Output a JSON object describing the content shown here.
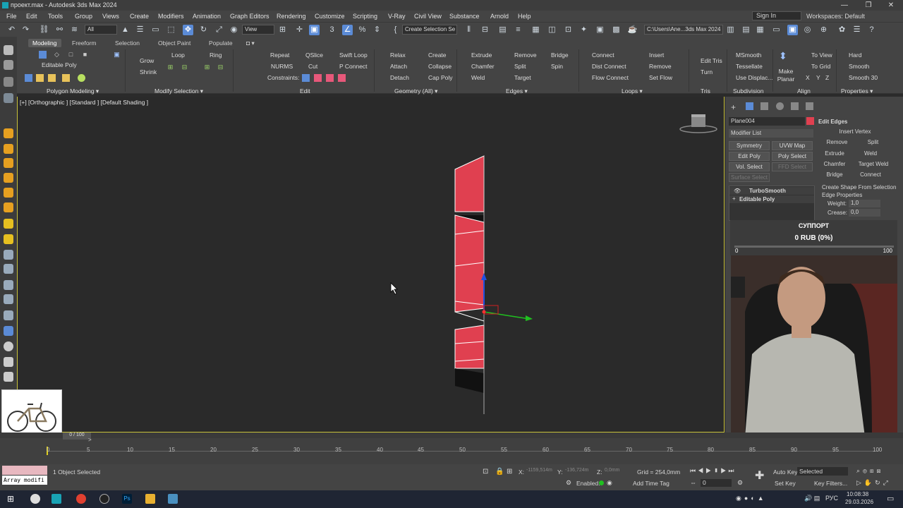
{
  "window": {
    "title": "проект.max - Autodesk 3ds Max 2024",
    "buttons": [
      "—",
      "❐",
      "✕"
    ]
  },
  "menu": {
    "items": [
      "File",
      "Edit",
      "Tools",
      "Group",
      "Views",
      "Create",
      "Modifiers",
      "Animation",
      "Graph Editors",
      "Rendering",
      "Customize",
      "Scripting",
      "V-Ray",
      "Civil View",
      "Substance",
      "Arnold",
      "Help"
    ],
    "signin": "Sign In",
    "workspaces": "Workspaces: Default"
  },
  "toolbar": {
    "filter": "All",
    "view": "View",
    "selset": "Create Selection Se",
    "path": "C:\\Users\\Ane...3ds Max 2024"
  },
  "ribbon": {
    "tabs": [
      "Modeling",
      "Freeform",
      "Selection",
      "Object Paint",
      "Populate"
    ],
    "editable_poly": "Editable Poly",
    "grow": "Grow",
    "shrink": "Shrink",
    "loop": "Loop",
    "ring": "Ring",
    "repeat": "Repeat",
    "qslice": "QSlice",
    "swift_loop": "Swift Loop",
    "nurms": "NURMS",
    "cut": "Cut",
    "p_connect": "P Connect",
    "constraints": "Constraints:",
    "relax": "Relax",
    "create": "Create",
    "attach": "Attach",
    "collapse": "Collapse",
    "detach": "Detach",
    "cap_poly": "Cap Poly",
    "extrude": "Extrude",
    "remove": "Remove",
    "bridge": "Bridge",
    "chamfer": "Chamfer",
    "split": "Split",
    "spin": "Spin",
    "weld": "Weld",
    "target": "Target",
    "connect": "Connect",
    "insert": "Insert",
    "dist_connect": "Dist Connect",
    "remove2": "Remove",
    "flow_connect": "Flow Connect",
    "set_flow": "Set Flow",
    "edit_tris": "Edit Tris",
    "turn": "Turn",
    "msmooth": "MSmooth",
    "tessellate": "Tessellate",
    "use_displac": "Use Displac...",
    "make_planar": "Make Planar",
    "to_view": "To View",
    "to_grid": "To Grid",
    "xyz": [
      "X",
      "Y",
      "Z"
    ],
    "hard": "Hard",
    "smooth": "Smooth",
    "smooth30": "Smooth 30",
    "groups": {
      "polygon_modeling": "Polygon Modeling ▾",
      "modify_selection": "Modify Selection ▾",
      "edit": "Edit",
      "geometry": "Geometry (All) ▾",
      "edges": "Edges ▾",
      "loops": "Loops ▾",
      "tris": "Tris",
      "subdivision": "Subdivision",
      "align": "Align",
      "properties": "Properties ▾"
    }
  },
  "viewport": {
    "label": "[+] [Orthographic ] [Standard ] [Default Shading ]"
  },
  "command_panel": {
    "object_name": "Plane004",
    "modifier_list": "Modifier List",
    "mod_buttons": [
      "Symmetry",
      "UVW Map",
      "Edit Poly",
      "Poly Select",
      "Vol. Select",
      "FFD Select",
      "Surface Select"
    ],
    "stack": [
      "TurboSmooth",
      "Editable Poly"
    ],
    "rollout_title": "Edit Edges",
    "insert_vertex": "Insert Vertex",
    "remove": "Remove",
    "split": "Split",
    "extrude": "Extrude",
    "weld": "Weld",
    "chamfer": "Chamfer",
    "target_weld": "Target Weld",
    "bridge": "Bridge",
    "connect": "Connect",
    "create_shape": "Create Shape From Selection",
    "edge_properties": "Edge Properties",
    "weight_label": "Weight:",
    "weight": "1,0",
    "crease_label": "Crease:",
    "crease": "0,0"
  },
  "support": {
    "title": "СУППОРТ",
    "amount": "0 RUB (0%)",
    "min": "0",
    "max": "100",
    "progress": 0
  },
  "timeline": {
    "ticks": [
      "0",
      "5",
      "10",
      "15",
      "20",
      "25",
      "30",
      "35",
      "40",
      "45",
      "50",
      "55",
      "60",
      "65",
      "70",
      "75",
      "80",
      "85",
      "90",
      "95",
      "100"
    ],
    "frame": "0 / 100"
  },
  "status": {
    "array": "Array modifi",
    "selected": "1 Object Selected",
    "x_label": "X:",
    "x": "-1159,514m",
    "y_label": "Y:",
    "y": "-136,724m",
    "z_label": "Z:",
    "z": "0,0mm",
    "grid": "Grid = 254,0mm",
    "enabled": "Enabled:",
    "add_time_tag": "Add Time Tag",
    "autokey": "Auto Key",
    "selected_dd": "Selected",
    "setkey": "Set Key",
    "keyfilters": "Key Filters...",
    "frame_field": "0"
  },
  "taskbar": {
    "lang": "РУС",
    "time": "10:08:38",
    "date": "29.03.2026"
  },
  "colors": {
    "accent": "#5b8bd6",
    "selection": "#e8587a",
    "viewport_border": "#c9c23a",
    "object_color": "#e04050"
  }
}
